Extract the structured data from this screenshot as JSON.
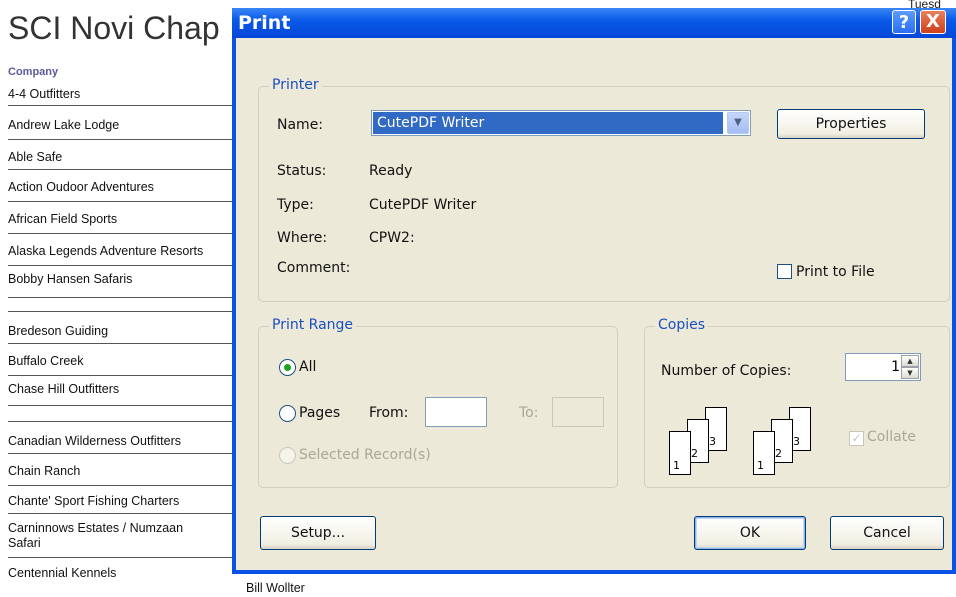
{
  "report": {
    "title": "SCI Novi Chap",
    "date_fragment": "Tuesd",
    "column_header": "Company",
    "companies": [
      "4-4 Outfitters",
      "Andrew Lake Lodge",
      "Able Safe",
      "Action Oudoor Adventures",
      "African Field Sports",
      "Alaska Legends Adventure Resorts",
      "Bobby Hansen Safaris",
      "",
      "Bredeson Guiding",
      "Buffalo Creek",
      "Chase Hill Outfitters",
      "",
      "Canadian Wilderness Outfitters",
      "Chain Ranch",
      "Chante' Sport Fishing Charters",
      "Carninnows Estates / Numzaan Safari",
      "Centennial Kennels"
    ],
    "contact_fragment": "Bill Wollter"
  },
  "dialog": {
    "title": "Print",
    "help_label": "?",
    "close_label": "X",
    "printer": {
      "group_label": "Printer",
      "name_label": "Name:",
      "name_value": "CutePDF Writer",
      "properties_label": "Properties",
      "status_label": "Status:",
      "status_value": "Ready",
      "type_label": "Type:",
      "type_value": "CutePDF Writer",
      "where_label": "Where:",
      "where_value": "CPW2:",
      "comment_label": "Comment:",
      "print_to_file_label": "Print to File"
    },
    "print_range": {
      "group_label": "Print Range",
      "all_label": "All",
      "pages_label": "Pages",
      "from_label": "From:",
      "to_label": "To:",
      "selected_label": "Selected Record(s)"
    },
    "copies": {
      "group_label": "Copies",
      "number_label": "Number of Copies:",
      "number_value": "1",
      "collate_label": "Collate",
      "page_numbers": [
        "1",
        "2",
        "3"
      ]
    },
    "buttons": {
      "setup": "Setup...",
      "ok": "OK",
      "cancel": "Cancel"
    }
  }
}
